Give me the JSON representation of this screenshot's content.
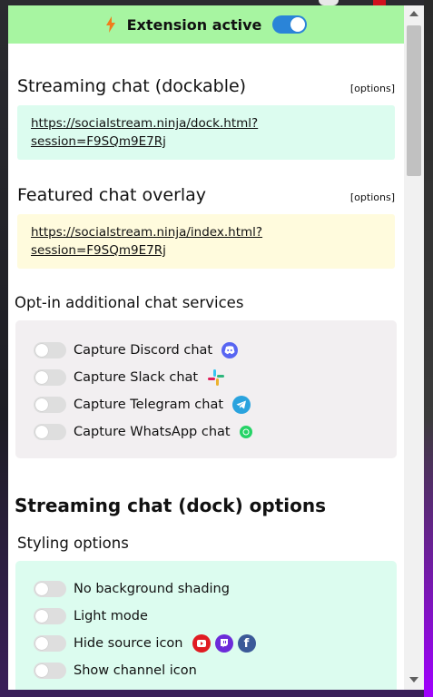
{
  "header": {
    "label": "Extension active",
    "enabled": true
  },
  "streaming_chat": {
    "title": "Streaming chat (dockable)",
    "options_label": "[options]",
    "url": "https://socialstream.ninja/dock.html?session=F9SQm9E7Rj"
  },
  "featured_chat": {
    "title": "Featured chat overlay",
    "options_label": "[options]",
    "url_line1": "https://socialstream.ninja/index.html?",
    "url_line2": "session=F9SQm9E7Rj"
  },
  "optin": {
    "title": "Opt-in additional chat services",
    "items": [
      {
        "label": "Capture Discord chat",
        "icon": "discord-icon",
        "color": "#5865f2"
      },
      {
        "label": "Capture Slack chat",
        "icon": "slack-icon",
        "color": "#e01e5a"
      },
      {
        "label": "Capture Telegram chat",
        "icon": "telegram-icon",
        "color": "#2aa3de"
      },
      {
        "label": "Capture WhatsApp chat",
        "icon": "whatsapp-icon",
        "color": "#25d366"
      }
    ]
  },
  "dock_options": {
    "title": "Streaming chat (dock) options",
    "styling_title": "Styling options",
    "items": [
      {
        "label": "No background shading"
      },
      {
        "label": "Light mode"
      },
      {
        "label": "Hide source icon"
      },
      {
        "label": "Show channel icon"
      }
    ]
  },
  "colors": {
    "header_bg": "#a7f5a1",
    "toggle_on": "#2a84d8",
    "url_green": "#dcfcef",
    "url_yellow": "#fffbdd"
  }
}
